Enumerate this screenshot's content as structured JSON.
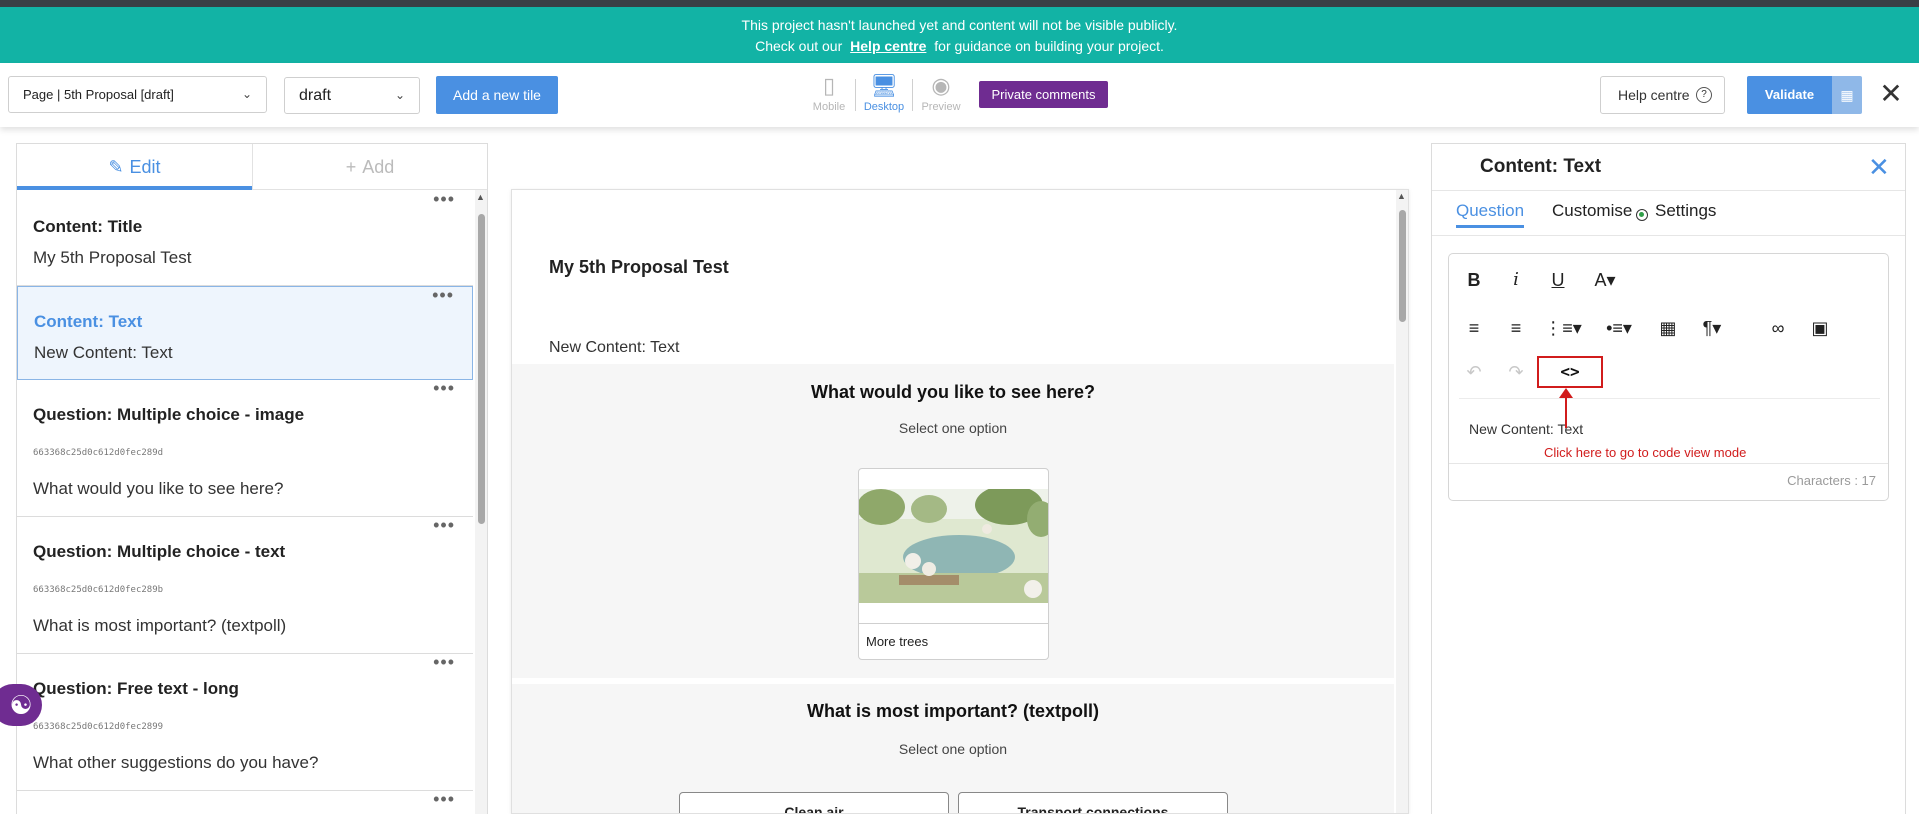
{
  "banner": {
    "line1": "This project hasn't launched yet and content will not be visible publicly.",
    "line2_prefix": "Check out our",
    "line2_link": "Help centre",
    "line2_suffix": "for guidance on building your project."
  },
  "toolbar": {
    "page_select": "Page | 5th Proposal [draft]",
    "status_select": "draft",
    "add_tile_label": "Add a new tile",
    "views": [
      {
        "label": "Mobile",
        "icon": "mobile-icon",
        "active": false
      },
      {
        "label": "Desktop",
        "icon": "desktop-icon",
        "active": true
      },
      {
        "label": "Preview",
        "icon": "eye-icon",
        "active": false
      }
    ],
    "private_comments_label": "Private comments",
    "help_centre_label": "Help centre",
    "validate_label": "Validate"
  },
  "left_panel": {
    "tabs": [
      {
        "label": "Edit",
        "icon": "pencil-icon",
        "active": true
      },
      {
        "label": "Add",
        "icon": "plus-icon",
        "active": false
      }
    ],
    "tiles": [
      {
        "title": "Content: Title",
        "id": "",
        "subtitle": "My 5th Proposal Test",
        "selected": false
      },
      {
        "title": "Content: Text",
        "id": "",
        "subtitle": "New Content: Text",
        "selected": true
      },
      {
        "title": "Question: Multiple choice - image",
        "id": "663368c25d0c612d0fec289d",
        "subtitle": "What would you like to see here?",
        "selected": false
      },
      {
        "title": "Question: Multiple choice - text",
        "id": "663368c25d0c612d0fec289b",
        "subtitle": "What is most important? (textpoll)",
        "selected": false
      },
      {
        "title": "Question: Free text - long",
        "id": "663368c25d0c612d0fec2899",
        "subtitle": "What other suggestions do you have?",
        "selected": false
      }
    ]
  },
  "preview": {
    "title": "My 5th Proposal Test",
    "text": "New Content: Text",
    "q1": {
      "title": "What would you like to see here?",
      "subtitle": "Select one option",
      "option_caption": "More trees"
    },
    "q2": {
      "title": "What is most important? (textpoll)",
      "subtitle": "Select one option",
      "options": [
        "Clean air",
        "Transport connections"
      ]
    }
  },
  "right_panel": {
    "title": "Content: Text",
    "tabs": [
      "Question",
      "Customise",
      "Settings"
    ],
    "editor_content": "New Content: Text",
    "annotation": "Click here to go to code view mode",
    "characters": "Characters : 17"
  },
  "colors": {
    "banner": "#12b3a5",
    "accent_blue": "#4a90e2",
    "purple": "#6f2c91",
    "annotation_red": "#d11c1c"
  }
}
